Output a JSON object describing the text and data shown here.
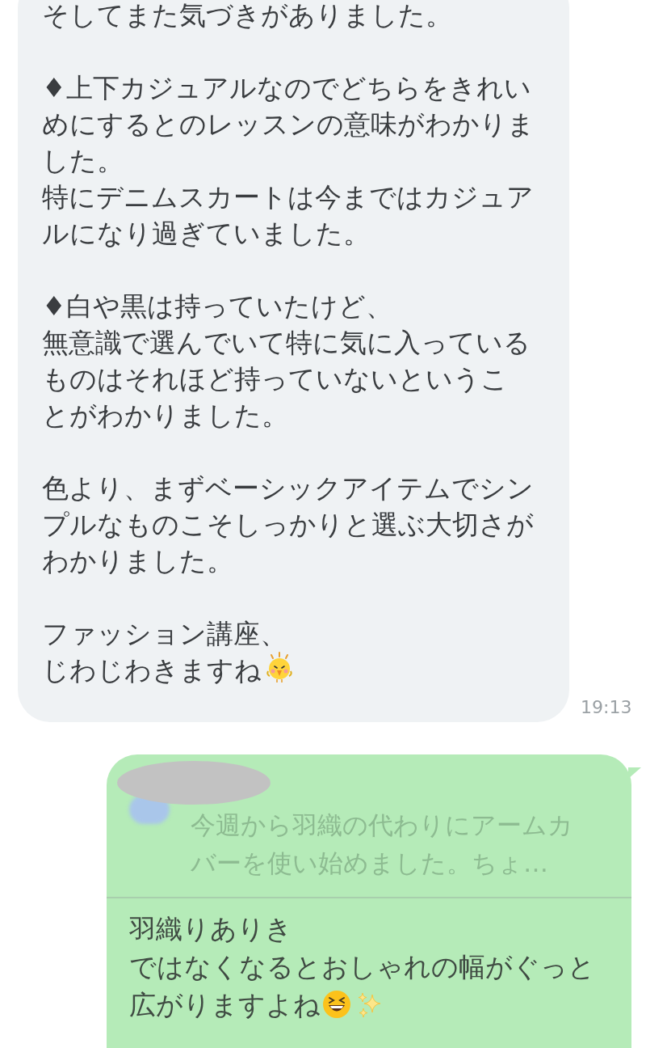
{
  "incoming": {
    "paragraphs": [
      [
        "そしてまた気づきがありました。"
      ],
      [
        "♦上下カジュアルなのでどちらをきれいめにするとのレッスンの意味がわかりました。",
        "特にデニムスカートは今まではカジュアルになり過ぎていました。"
      ],
      [
        "♦白や黒は持っていたけど、",
        "無意識で選んでいて特に気に入っているものはそれほど持っていないということがわかりました。"
      ],
      [
        "色より、まずベーシックアイテムでシンプルなものこそしっかりと選ぶ大切さがわかりました。"
      ],
      [
        "ファッション講座、",
        "じわじわきますね"
      ]
    ],
    "time": "19:13"
  },
  "outgoing": {
    "quote": {
      "text": "今週から羽織の代わりにアームカバーを使い始めました。ちょ…"
    },
    "lines": [
      "羽織りありき",
      "ではなくなるとおしゃれの幅がぐっと広がりますよね"
    ]
  }
}
